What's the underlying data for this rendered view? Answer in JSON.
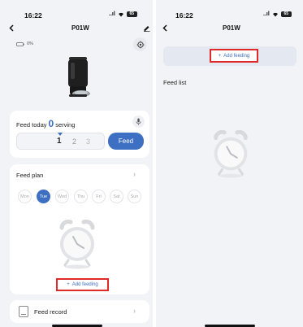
{
  "left": {
    "status_time": "16:22",
    "status_signal": "..ıl",
    "status_battery": "65",
    "title": "P01W",
    "battery_level": "0%",
    "feed_today_label": "Feed today",
    "feed_today_count": "0",
    "feed_today_unit": "serving",
    "portion_values": [
      "1",
      "2",
      "3"
    ],
    "feed_button": "Feed",
    "feed_plan_label": "Feed plan",
    "days": [
      "Mon",
      "Tue",
      "Wed",
      "Thu",
      "Fri",
      "Sat",
      "Sun"
    ],
    "add_feeding": "Add feeding",
    "feed_record_label": "Feed record"
  },
  "right": {
    "status_time": "16:22",
    "status_signal": "..ıl",
    "status_battery": "65",
    "title": "P01W",
    "add_feeding": "Add feeding",
    "feed_list_label": "Feed list"
  },
  "colors": {
    "accent": "#3d6fc2",
    "highlight": "#e02a2a",
    "background": "#f2f3f6"
  }
}
